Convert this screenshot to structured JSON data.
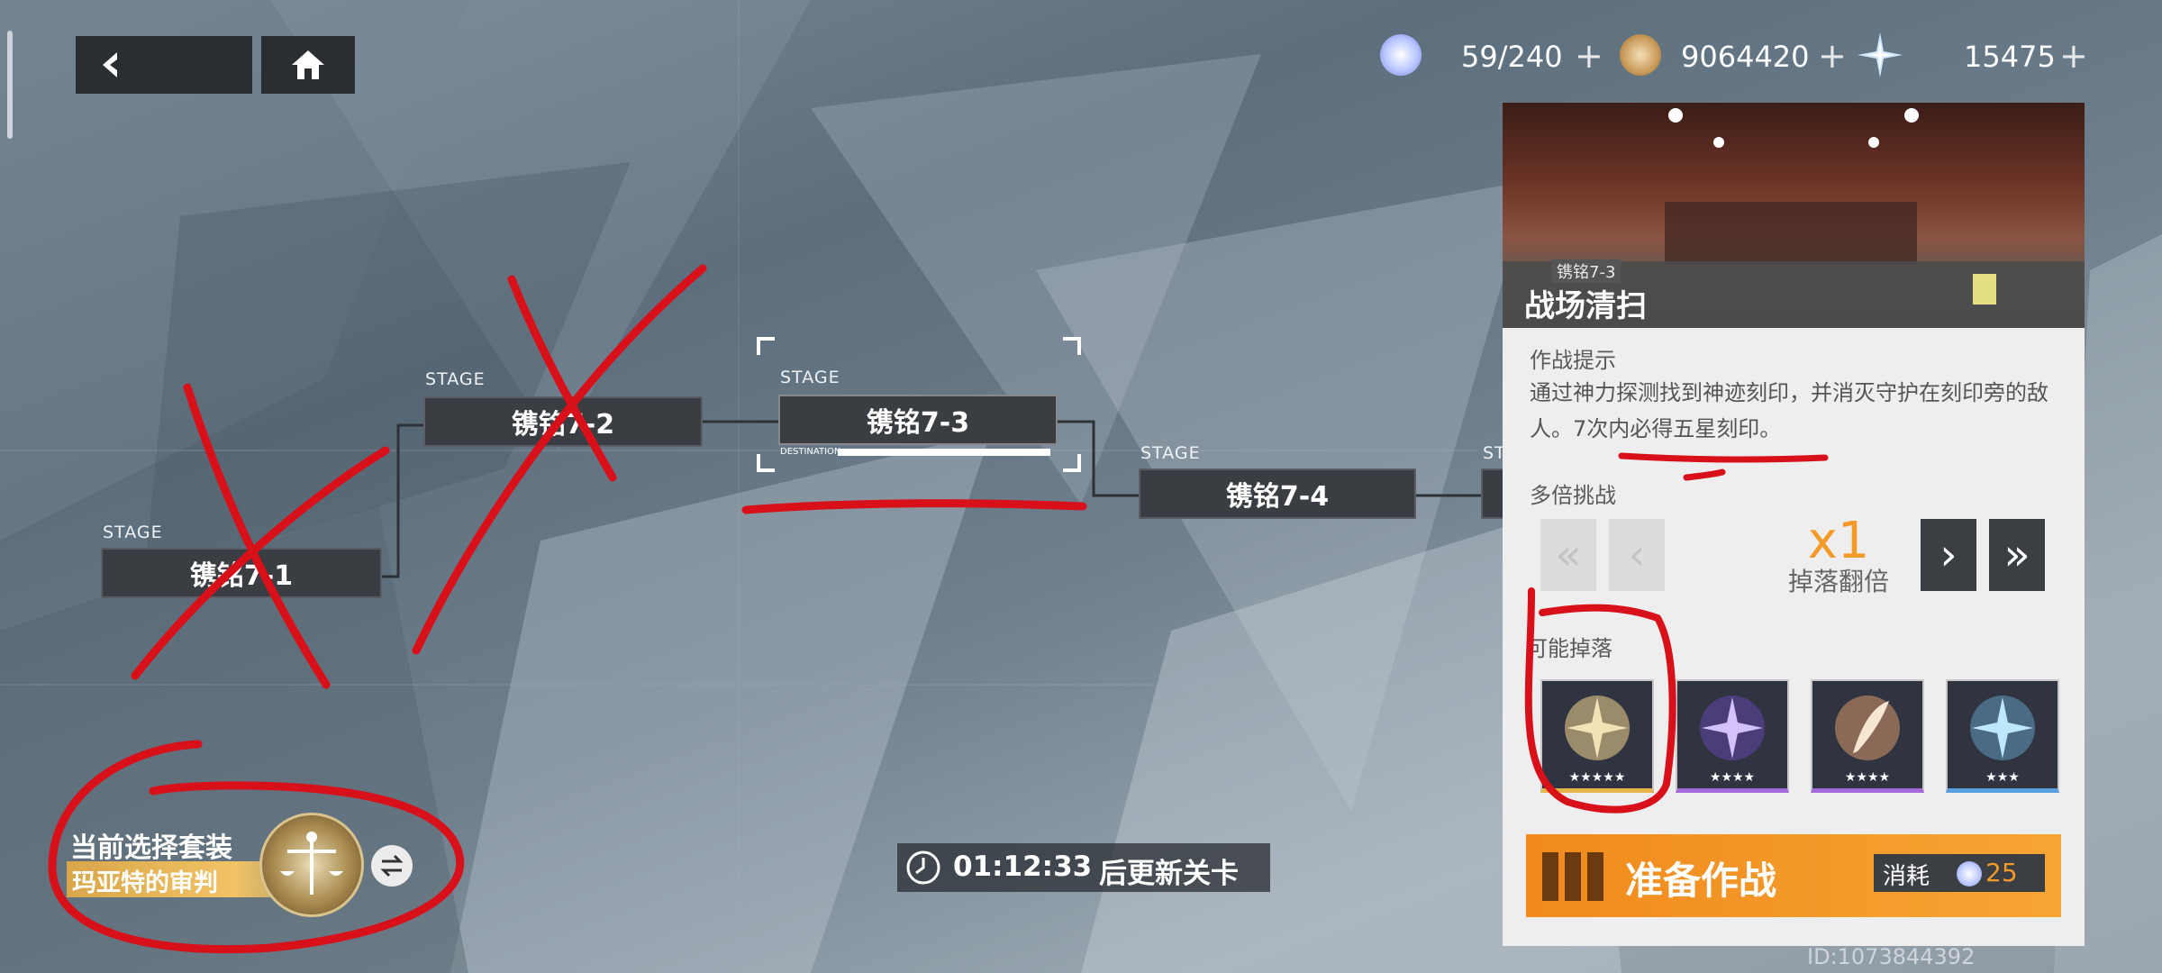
{
  "resources": {
    "stamina": "59/240",
    "coins": "9064420",
    "crystals": "15475",
    "plus": "+"
  },
  "stages": [
    {
      "tag": "STAGE",
      "name": "镌铭7-1"
    },
    {
      "tag": "STAGE",
      "name": "镌铭7-2"
    },
    {
      "tag": "STAGE",
      "name": "镌铭7-3",
      "destination": "DESTINATION"
    },
    {
      "tag": "STAGE",
      "name": "镌铭7-4"
    },
    {
      "tag": "ST"
    }
  ],
  "panel": {
    "stage_code": "镌铭7-3",
    "stage_title": "战场清扫",
    "tips_label": "作战提示",
    "tips_text": "通过神力探测找到神迹刻印，并消灭守护在刻印旁的敌人。7次内必得五星刻印。",
    "multi_label": "多倍挑战",
    "multiplier": "x1",
    "multiplier_desc": "掉落翻倍",
    "drops_label": "可能掉落",
    "drops": [
      {
        "stars": "★★★★★"
      },
      {
        "stars": "★★★★"
      },
      {
        "stars": "★★★★"
      },
      {
        "stars": "★★★"
      }
    ],
    "prepare_label": "准备作战",
    "cost_label": "消耗",
    "cost_value": "25"
  },
  "suit": {
    "label": "当前选择套装",
    "name": "玛亚特的审判"
  },
  "timer": {
    "time": "01:12:33",
    "suffix": "后更新关卡"
  },
  "uid": "ID:1073844392",
  "colors": {
    "accent_orange": "#f39a2a",
    "annotation_red": "#d8101a",
    "panel_bg": "#eeeeee",
    "node_bg": "#3a3d42"
  }
}
